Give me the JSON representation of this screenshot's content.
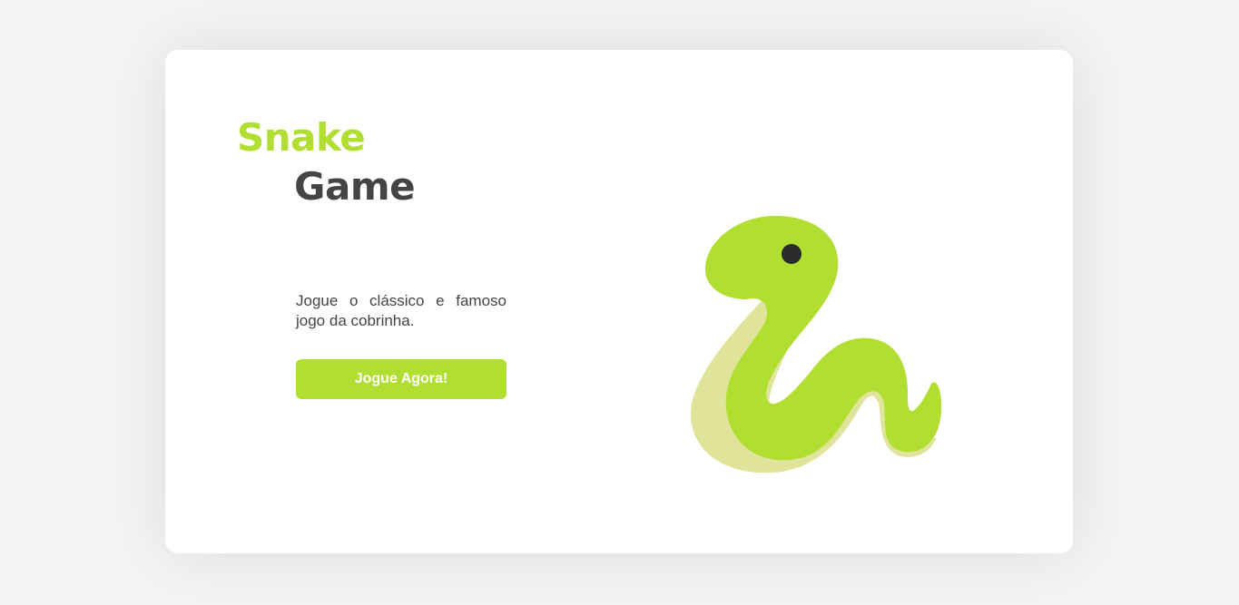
{
  "hero": {
    "title_line1": "Snake",
    "title_line2": "Game",
    "description": "Jogue o clássico e famoso jogo da cobrinha.",
    "play_button_label": "Jogue Agora!"
  },
  "illustration": {
    "icon": "snake-illustration"
  },
  "colors": {
    "accent": "#b0de31",
    "snake_shadow": "#e0e49b",
    "text_dark": "#444444",
    "eye": "#2b2b2b",
    "page_bg": "#f4f4f4",
    "card_bg": "#ffffff"
  }
}
